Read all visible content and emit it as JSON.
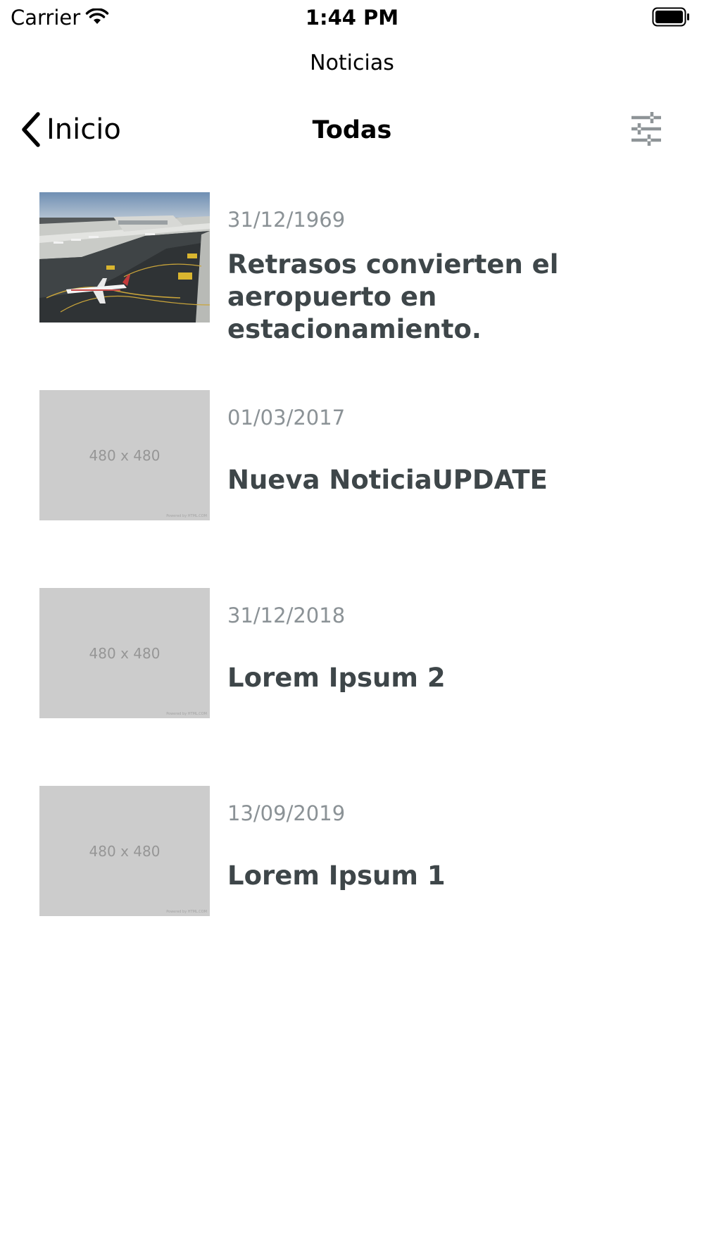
{
  "status_bar": {
    "carrier": "Carrier",
    "time": "1:44 PM"
  },
  "app": {
    "title": "Noticias"
  },
  "nav": {
    "back_label": "Inicio",
    "title": "Todas",
    "filter_icon": "sliders-icon"
  },
  "news": [
    {
      "date": "31/12/1969",
      "title": "Retrasos convierten el aeropuerto en estacionamiento.",
      "thumbnail": "airport-photo"
    },
    {
      "date": "01/03/2017",
      "title": "Nueva NoticiaUPDATE",
      "thumbnail_text": "480 x 480",
      "thumbnail_footer": "Powered by HTML.COM"
    },
    {
      "date": "31/12/2018",
      "title": "Lorem Ipsum 2",
      "thumbnail_text": "480 x 480",
      "thumbnail_footer": "Powered by HTML.COM"
    },
    {
      "date": "13/09/2019",
      "title": "Lorem Ipsum 1",
      "thumbnail_text": "480 x 480",
      "thumbnail_footer": "Powered by HTML.COM"
    }
  ],
  "colors": {
    "title_text": "#3e4649",
    "date_text": "#8b9296",
    "placeholder_bg": "#cccccc",
    "icon_gray": "#8e9497"
  }
}
